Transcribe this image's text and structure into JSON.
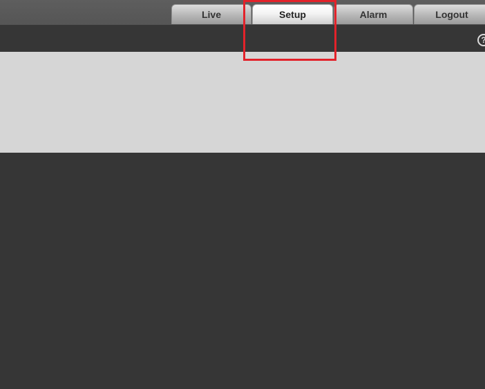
{
  "nav": {
    "tabs": [
      {
        "label": "Live",
        "active": false
      },
      {
        "label": "Setup",
        "active": true
      },
      {
        "label": "Alarm",
        "active": false
      },
      {
        "label": "Logout",
        "active": false
      }
    ]
  },
  "toolbar": {
    "help_icon": "help-circle-icon",
    "help_glyph": "?"
  },
  "colors": {
    "top_bar": "#555555",
    "sub_bar": "#363636",
    "content_panel": "#d6d6d6",
    "highlight": "#e3222a"
  }
}
